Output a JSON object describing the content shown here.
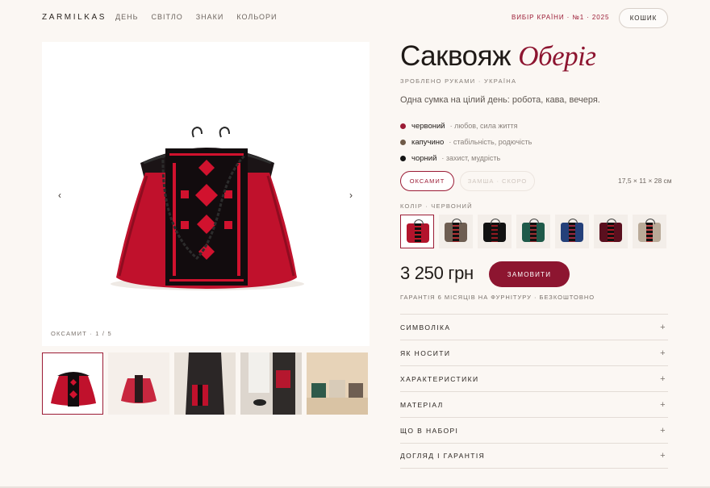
{
  "header": {
    "logo": "ZARMILKAS",
    "nav": [
      "ДЕНЬ",
      "СВІТЛО",
      "ЗНАКИ",
      "КОЛЬОРИ"
    ],
    "choice": "ВИБІР КРАЇНИ · №1 · 2025",
    "cart": "КОШИК"
  },
  "gallery": {
    "caption": "ОКСАМИТ · 1 / 5",
    "prev": "‹",
    "next": "›",
    "thumbs": [
      "thumb-1",
      "thumb-2",
      "thumb-3",
      "thumb-4",
      "thumb-5"
    ]
  },
  "product": {
    "title": "Саквояж",
    "title_accent": "Оберіг",
    "made": "ЗРОБЛЕНО РУКАМИ · УКРАЇНА",
    "lead": "Одна сумка на цілий день: робота, кава, вечеря.",
    "symbols": [
      {
        "name": "червоний",
        "meaning": "· любов, сила життя",
        "color": "#9b1b35"
      },
      {
        "name": "капучино",
        "meaning": "· стабільність, родючість",
        "color": "#6f5a48"
      },
      {
        "name": "чорний",
        "meaning": "· захист, мудрість",
        "color": "#141414"
      }
    ],
    "materials": {
      "active": "ОКСАМИТ",
      "inactive": "ЗАМША · СКОРО"
    },
    "dimensions": "17,5 × 11 × 28 см",
    "color_label": "КОЛІР · ЧЕРВОНИЙ",
    "swatches": [
      "#b3142c",
      "#6e5e52",
      "#111111",
      "#1f5a4a",
      "#24407a",
      "#5a0f1e",
      "#b9aa98"
    ],
    "price": "3 250 грн",
    "order": "ЗАМОВИТИ",
    "warranty": "ГАРАНТІЯ 6 МІСЯЦІВ НА ФУРНІТУРУ · БЕЗКОШТОВНО"
  },
  "accordion": [
    {
      "label": "СИМВОЛІКА",
      "icon": "+"
    },
    {
      "label": "ЯК НОСИТИ",
      "icon": "+"
    },
    {
      "label": "ХАРАКТЕРИСТИКИ",
      "icon": "+"
    },
    {
      "label": "МАТЕРІАЛ",
      "icon": "+"
    },
    {
      "label": "ЩО В НАБОРІ",
      "icon": "+"
    },
    {
      "label": "ДОГЛЯД І ГАРАНТІЯ",
      "icon": "+"
    }
  ]
}
